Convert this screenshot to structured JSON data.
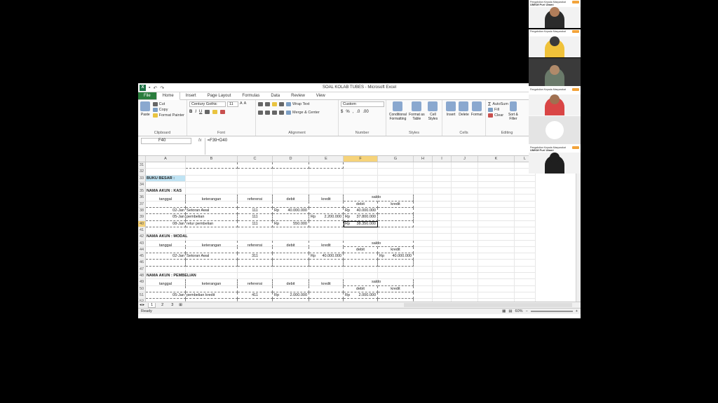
{
  "window": {
    "title": "SOAL KOLAB TUBES  -  Microsoft Excel"
  },
  "tabs": [
    "File",
    "Home",
    "Insert",
    "Page Layout",
    "Formulas",
    "Data",
    "Review",
    "View"
  ],
  "ribbon": {
    "clipboard": {
      "label": "Clipboard",
      "paste": "Paste",
      "cut": "Cut",
      "copy": "Copy",
      "format_painter": "Format Painter"
    },
    "font": {
      "label": "Font",
      "name": "Century Gothic",
      "size": "11"
    },
    "alignment": {
      "label": "Alignment",
      "wrap": "Wrap Text",
      "merge": "Merge & Center"
    },
    "number": {
      "label": "Number",
      "format": "Custom"
    },
    "styles": {
      "label": "Styles",
      "conditional": "Conditional Formatting",
      "format_table": "Format as Table",
      "cell_styles": "Cell Styles"
    },
    "cells": {
      "label": "Cells",
      "insert": "Insert",
      "delete": "Delete",
      "format": "Format"
    },
    "editing": {
      "label": "Editing",
      "autosum": "AutoSum",
      "fill": "Fill",
      "clear": "Clear",
      "sort": "Sort & Filter"
    }
  },
  "formula_bar": {
    "name_box": "F40",
    "fx": "fx",
    "formula": "=F39+D40"
  },
  "columns": [
    "A",
    "B",
    "C",
    "D",
    "E",
    "F",
    "G",
    "H",
    "I",
    "J",
    "K",
    "L"
  ],
  "rows": {
    "r31": {
      "n": "31"
    },
    "r32": {
      "n": "32"
    },
    "r33": {
      "n": "33",
      "a": "BUKU BESAR :"
    },
    "r34": {
      "n": "34"
    },
    "r35": {
      "n": "35",
      "a": "NAMA AKUN : KAS"
    },
    "r36": {
      "n": "36",
      "a": "tanggal",
      "b": "keterangan",
      "c": "referensi",
      "d": "debit",
      "e": "kredit",
      "f": "saldo"
    },
    "r37": {
      "n": "37",
      "f": "debit",
      "g": "kredit"
    },
    "r38": {
      "n": "38",
      "a": "02-Jan",
      "b": "Setoran Awal",
      "c": "111",
      "d_rp": "Rp",
      "d": "40.000.000",
      "f_rp": "Rp",
      "f": "40.000.000"
    },
    "r39": {
      "n": "39",
      "a": "05-Jan",
      "b": "pembelian",
      "c": "111",
      "e_rp": "Rp",
      "e": "2.200.000",
      "f_rp": "Rp",
      "f": "37.800.000"
    },
    "r40": {
      "n": "40",
      "a": "08-Jan",
      "b": "retur pembelian",
      "c": "111",
      "d_rp": "Rp",
      "d": "550.000",
      "f_rp": "Rp",
      "f": "38.350.000"
    },
    "r41": {
      "n": "41"
    },
    "r42": {
      "n": "42",
      "a": "NAMA AKUN : MODAL"
    },
    "r43": {
      "n": "43",
      "a": "tanggal",
      "b": "keterangan",
      "c": "referensi",
      "d": "debit",
      "e": "kredit",
      "f": "saldo"
    },
    "r44": {
      "n": "44",
      "f": "debit",
      "g": "kredit"
    },
    "r45": {
      "n": "45",
      "a": "02-Jan",
      "b": "Setoran Awal",
      "c": "311",
      "e_rp": "Rp",
      "e": "40.000.000",
      "g_rp": "Rp",
      "g": "40.000.000"
    },
    "r46": {
      "n": "46"
    },
    "r47": {
      "n": "47"
    },
    "r48": {
      "n": "48",
      "a": "NAMA AKUN : PEMBELIAN"
    },
    "r49": {
      "n": "49",
      "a": "tanggal",
      "b": "keterangan",
      "c": "referensi",
      "d": "debit",
      "e": "kredit",
      "f": "saldo"
    },
    "r50": {
      "n": "50",
      "f": "debit",
      "g": "kredit"
    },
    "r51": {
      "n": "51",
      "a": "05-Jan",
      "b": "pembelian kredit",
      "c": "411",
      "d_rp": "Rp",
      "d": "2.000.000",
      "f_rp": "Rp",
      "f": "2.000.000"
    },
    "r52": {
      "n": "52"
    },
    "r53": {
      "n": "53"
    }
  },
  "sheets": [
    "1",
    "2",
    "3"
  ],
  "status": {
    "ready": "Ready",
    "zoom": "60%"
  },
  "participants": [
    {
      "org": "Pengabdian Kepada Masyarakat",
      "name": "UMKM Puri Utami"
    },
    {
      "org": "Pengabdian Kepada Masyarakat",
      "name": ""
    },
    {
      "org": "",
      "name": ""
    },
    {
      "org": "Pengabdian Kepada Masyarakat",
      "name": ""
    },
    {
      "org": "",
      "name": ""
    },
    {
      "org": "Pengabdian Kepada Masyarakat",
      "name": "UMKM Puri Utami"
    }
  ]
}
